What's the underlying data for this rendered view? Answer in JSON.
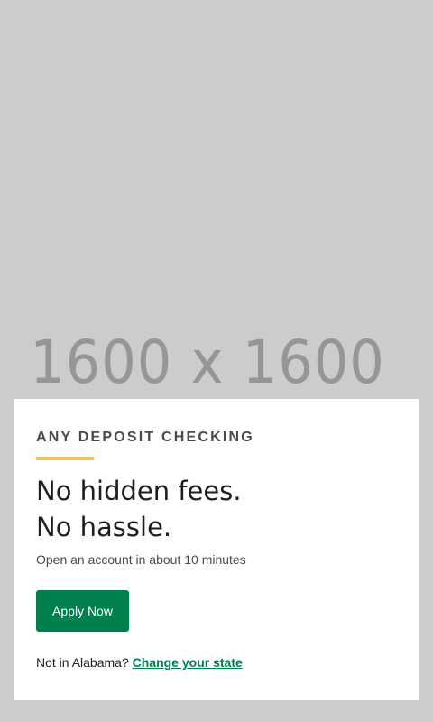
{
  "hero": {
    "placeholder_text": "1600 x 1600",
    "background_color": "#cccccc"
  },
  "card": {
    "eyebrow": "ANY DEPOSIT CHECKING",
    "headline_line1": "No hidden fees.",
    "headline_line2": "No hassle.",
    "subtext": "Open an account in about 10 minutes",
    "apply_button_label": "Apply Now",
    "state_prompt": "Not in Alabama?",
    "change_state_link": "Change your state"
  },
  "colors": {
    "accent": "#f2c267",
    "brand_green": "#00804d"
  }
}
